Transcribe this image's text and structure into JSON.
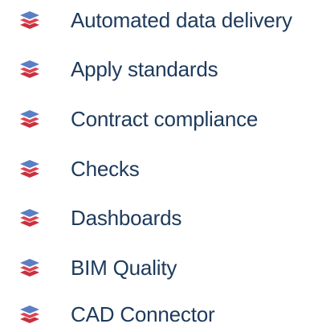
{
  "features": {
    "icon": "layered-stack-icon",
    "colors": {
      "text": "#1d3a5c",
      "icon_top": "#5b7fc4",
      "icon_middle": "#e0414f",
      "icon_bottom": "#c7303d"
    },
    "items": [
      {
        "label": "Automated data delivery"
      },
      {
        "label": "Apply standards"
      },
      {
        "label": "Contract compliance"
      },
      {
        "label": "Checks"
      },
      {
        "label": "Dashboards"
      },
      {
        "label": "BIM Quality"
      },
      {
        "label": "CAD Connector"
      }
    ]
  }
}
